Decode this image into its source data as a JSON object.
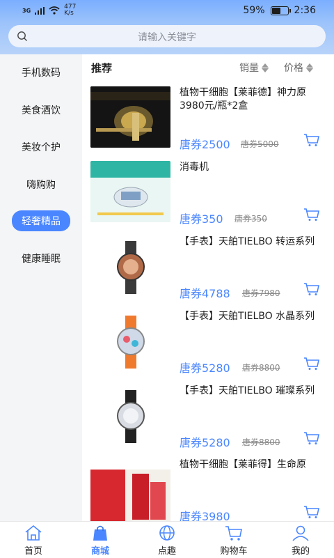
{
  "status": {
    "network": "3G",
    "speed": "477",
    "speed_unit": "K/s",
    "battery": "59%",
    "battery_level": 0.59,
    "time": "2:36"
  },
  "search": {
    "placeholder": "请输入关键字"
  },
  "sidebar": {
    "items": [
      {
        "label": "手机数码",
        "active": false
      },
      {
        "label": "美食酒饮",
        "active": false
      },
      {
        "label": "美妆个护",
        "active": false
      },
      {
        "label": "嗨购购",
        "active": false
      },
      {
        "label": "轻奢精品",
        "active": true
      },
      {
        "label": "健康睡眠",
        "active": false
      }
    ]
  },
  "sort": {
    "title": "推荐",
    "sales": "销量",
    "price": "价格"
  },
  "products": [
    {
      "name": "植物干细胞【莱菲德】神力原3980元/瓶*2盒",
      "price": "唐券2500",
      "old_price": "唐券5000"
    },
    {
      "name": "消毒机",
      "price": "唐券350",
      "old_price": "唐券350"
    },
    {
      "name": "【手表】天舶TIELBO 转运系列",
      "price": "唐券4788",
      "old_price": "唐券7980"
    },
    {
      "name": "【手表】天舶TIELBO 水晶系列",
      "price": "唐券5280",
      "old_price": "唐券8800"
    },
    {
      "name": "【手表】天舶TIELBO 璀璨系列",
      "price": "唐券5280",
      "old_price": "唐券8800"
    },
    {
      "name": "植物干细胞【莱菲得】生命原",
      "price": "唐券3980",
      "old_price": ""
    }
  ],
  "nav": {
    "items": [
      {
        "label": "首页",
        "icon": "home-icon"
      },
      {
        "label": "商城",
        "icon": "shopping-bag-icon"
      },
      {
        "label": "点趣",
        "icon": "globe-icon"
      },
      {
        "label": "购物车",
        "icon": "cart-icon"
      },
      {
        "label": "我的",
        "icon": "user-icon"
      }
    ],
    "active_index": 1
  },
  "colors": {
    "accent": "#4a86ff",
    "header_bg": "#9cc3fb",
    "sidebar_bg": "#f4f5f7"
  }
}
